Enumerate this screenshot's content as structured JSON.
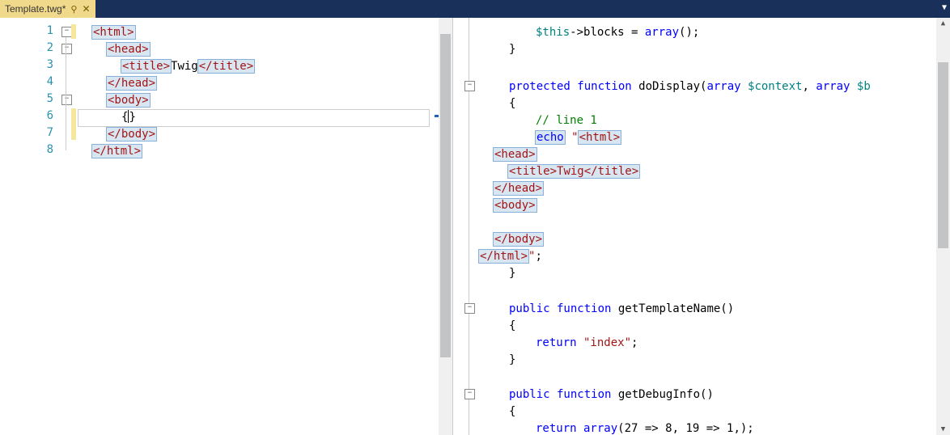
{
  "tab": {
    "title": "Template.twg*",
    "pin_icon": "📌"
  },
  "left": {
    "lines": [
      "1",
      "2",
      "3",
      "4",
      "5",
      "6",
      "7",
      "8"
    ],
    "code": {
      "l1a": "<html>",
      "l2a": "<head>",
      "l3a": "<title>",
      "l3b": "Twig",
      "l3c": "</title>",
      "l4a": "</head>",
      "l5a": "<body>",
      "l6a": "{",
      "l6b": "}",
      "l7a": "</body>",
      "l8a": "</html>"
    }
  },
  "right": {
    "r1a": "$this",
    "r1b": "->blocks = ",
    "r1c": "array",
    "r1d": "();",
    "r2a": "}",
    "r4a": "protected",
    "r4b": " function",
    "r4c": " doDisplay(",
    "r4d": "array",
    "r4e": " $context",
    "r4f": ", ",
    "r4g": "array",
    "r4h": " $b",
    "r5a": "{",
    "r6a": "// line 1",
    "r7a": "echo",
    "r7b": " \"",
    "r7c": "<html>",
    "r8a": "<head>",
    "r9a": "<title>",
    "r9b": "Twig",
    "r9c": "</title>",
    "r10a": "</head>",
    "r11a": "<body>",
    "r13a": "</body>",
    "r14a": "</html>",
    "r14b": "\"",
    "r14c": ";",
    "r15a": "}",
    "r17a": "public",
    "r17b": " function",
    "r17c": " getTemplateName()",
    "r18a": "{",
    "r19a": "return",
    "r19b": " \"index\"",
    "r19c": ";",
    "r20a": "}",
    "r22a": "public",
    "r22b": " function",
    "r22c": " getDebugInfo()",
    "r23a": "{",
    "r24a": "return",
    "r24b": " array",
    "r24c": "(27 => 8, 19 => 1,);"
  }
}
